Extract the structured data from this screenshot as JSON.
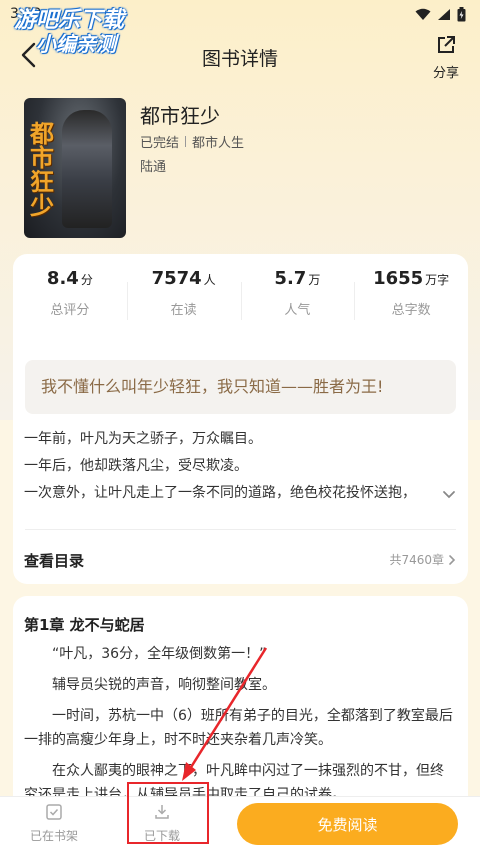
{
  "status_bar": {
    "time": "3:53"
  },
  "watermark": {
    "line1": "游吧乐下载",
    "line2": "小编亲测"
  },
  "header": {
    "title": "图书详情",
    "share_label": "分享"
  },
  "book": {
    "cover_title": "都市狂少",
    "title": "都市狂少",
    "status": "已完结",
    "category": "都市人生",
    "author": "陆通"
  },
  "stats": [
    {
      "value": "8.4",
      "unit": "分",
      "label": "总评分"
    },
    {
      "value": "7574",
      "unit": "人",
      "label": "在读"
    },
    {
      "value": "5.7",
      "unit": "万",
      "label": "人气"
    },
    {
      "value": "1655",
      "unit": "万字",
      "label": "总字数"
    }
  ],
  "quote": "我不懂什么叫年少轻狂，我只知道——胜者为王!",
  "description": [
    "一年前，叶凡为天之骄子，万众瞩目。",
    "一年后，他却跌落凡尘，受尽欺凌。",
    "一次意外，让叶凡走上了一条不同的道路，绝色校花投怀送抱，"
  ],
  "toc": {
    "title": "查看目录",
    "count": "共7460章"
  },
  "chapter": {
    "title": "第1章 龙不与蛇居",
    "paragraphs": [
      "“叶凡，36分，全年级倒数第一！”",
      "辅导员尖锐的声音，响彻整间教室。",
      "一时间，苏杭一中（6）班所有弟子的目光，全都落到了教室最后一排的高瘦少年身上，时不时还夹杂着几声冷笑。",
      "在众人鄙夷的眼神之下，叶凡眸中闪过了一抹强烈的不甘，但终究还是走上讲台，从辅导员手中取走了自己的试卷。"
    ]
  },
  "bottom_bar": {
    "shelf_label": "已在书架",
    "download_label": "已下载",
    "read_label": "免费阅读"
  },
  "colors": {
    "accent": "#fbac1f",
    "annotation": "#e8262b"
  }
}
